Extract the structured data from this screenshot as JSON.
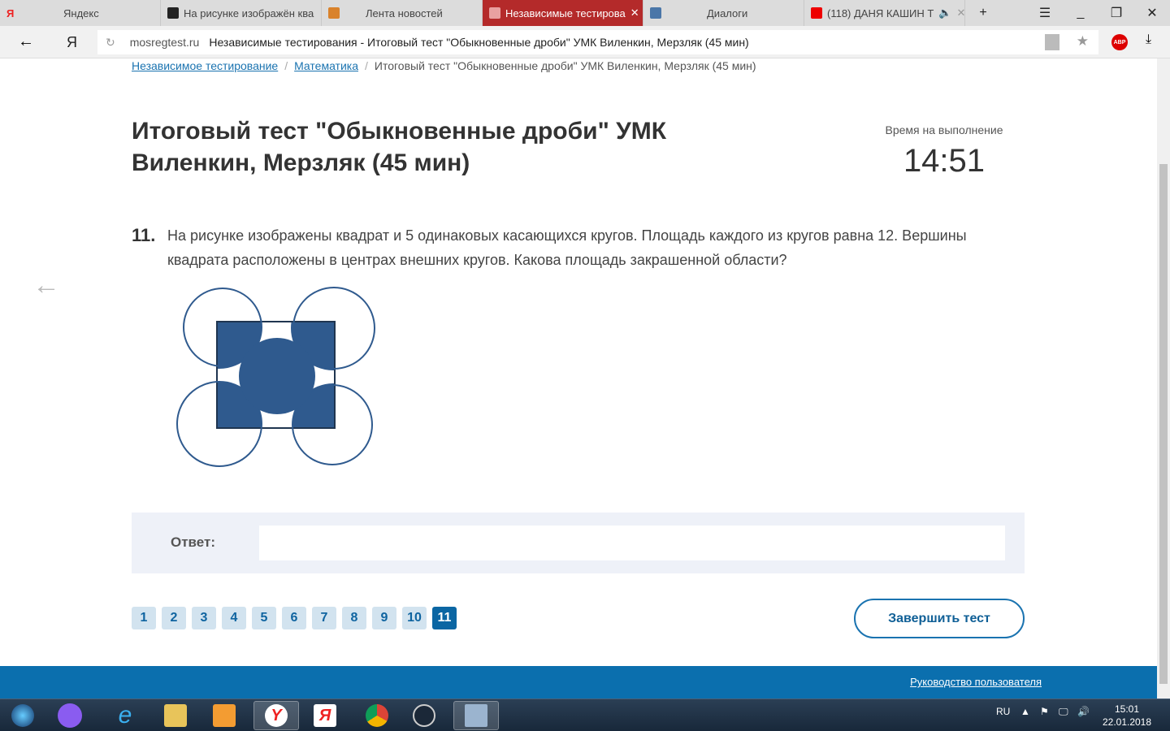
{
  "browser": {
    "tabs": [
      {
        "label": "Яндекс",
        "icon": "yandex-icon"
      },
      {
        "label": "На рисунке изображён ква",
        "icon": "znanija-icon"
      },
      {
        "label": "Лента новостей",
        "icon": "mosreg-icon"
      },
      {
        "label": "Независимые тестирова",
        "icon": "mosreg-icon",
        "active": true
      },
      {
        "label": "Диалоги",
        "icon": "vk-icon"
      },
      {
        "label": "(118) ДАНЯ КАШИН Т",
        "icon": "youtube-icon"
      }
    ],
    "new_tab": "+",
    "url_host": "mosregtest.ru",
    "url_title": "Независимые тестирования - Итоговый тест \"Обыкновенные дроби\" УМК Виленкин, Мерзляк (45 мин)",
    "abp": "ABP"
  },
  "breadcrumb": [
    "Независимое тестирование",
    "Математика",
    "Итоговый тест \"Обыкновенные дроби\" УМК Виленкин, Мерзляк (45 мин)"
  ],
  "title": "Итоговый тест \"Обыкновенные дроби\" УМК Виленкин, Мерзляк (45 мин)",
  "timer": {
    "label": "Время на выполнение",
    "value": "14:51"
  },
  "question": {
    "number": "11.",
    "text": "На рисунке изображены квадрат и 5 одинаковых касающихся кругов. Площадь каждого из кругов равна 12. Вершины квадрата расположены в центрах внешних кругов. Какова площадь закрашенной области?"
  },
  "answer": {
    "label": "Ответ:",
    "value": ""
  },
  "pages": [
    "1",
    "2",
    "3",
    "4",
    "5",
    "6",
    "7",
    "8",
    "9",
    "10",
    "11"
  ],
  "current_page": "11",
  "finish_label": "Завершить тест",
  "footer_link": "Руководство пользователя",
  "colors": {
    "accent": "#0b6fae",
    "figure": "#2f5a8e",
    "tab_active": "#b42a2a"
  },
  "taskbar": {
    "lang": "RU",
    "time": "15:01",
    "date": "22.01.2018"
  }
}
